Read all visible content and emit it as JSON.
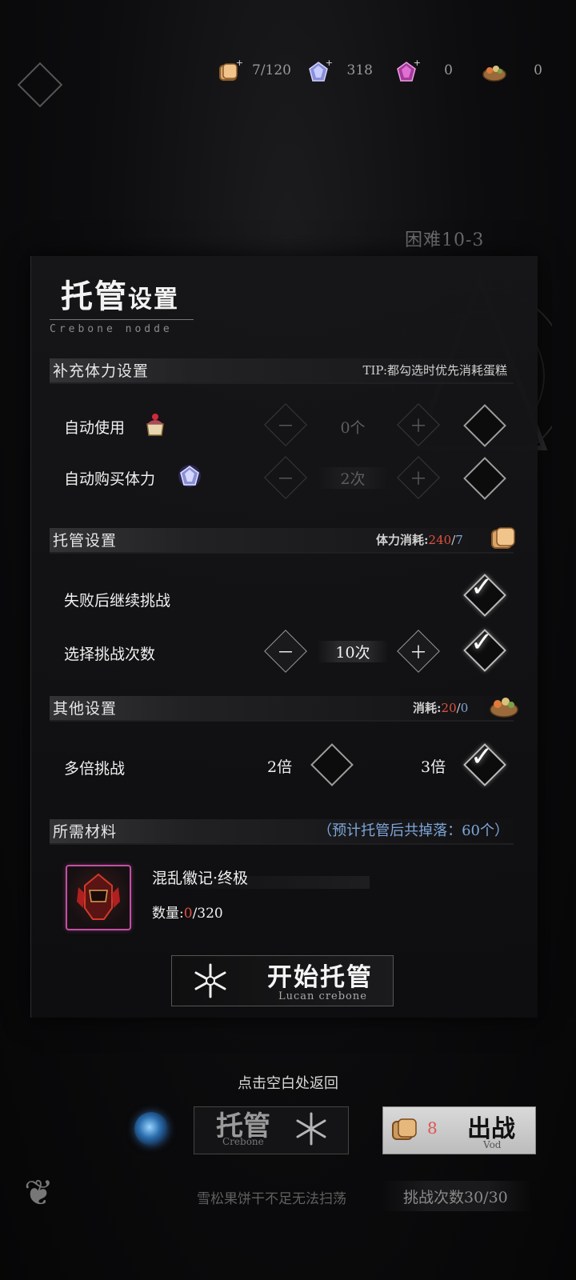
{
  "resources": [
    {
      "icon": "bread-icon",
      "value": "7/120"
    },
    {
      "icon": "blue-crystal-icon",
      "value": "318"
    },
    {
      "icon": "purple-crystal-icon",
      "value": "0"
    },
    {
      "icon": "food-basket-icon",
      "value": "0"
    }
  ],
  "background": {
    "stage": "困难10-3"
  },
  "panel": {
    "title_big": "托管",
    "title_small": "设置",
    "subtitle": "Crebone nodde",
    "stamina_section": {
      "title": "补充体力设置",
      "tip": "TIP:都勾选时优先消耗蛋糕",
      "rows": [
        {
          "label": "自动使用",
          "value": "0个",
          "icon": "cake-icon",
          "checked": false
        },
        {
          "label": "自动购买体力",
          "value": "2次",
          "icon": "crystal-icon",
          "checked": false
        }
      ]
    },
    "auto_section": {
      "title": "托管设置",
      "cost_label": "体力消耗:",
      "cost_used": "240",
      "cost_sep": "/",
      "cost_have": "7",
      "rows": [
        {
          "label": "失败后继续挑战",
          "checked": true
        },
        {
          "label": "选择挑战次数",
          "value": "10次",
          "checked": true
        }
      ]
    },
    "other_section": {
      "title": "其他设置",
      "cost_label": "消耗:",
      "cost_used": "20",
      "cost_sep": "/",
      "cost_have": "0",
      "multi": {
        "label": "多倍挑战",
        "opt2": "2倍",
        "opt3": "3倍",
        "opt2_checked": false,
        "opt3_checked": true
      }
    },
    "materials_section": {
      "title": "所需材料",
      "drop_note": "（预计托管后共掉落：60个）",
      "item": {
        "name": "混乱徽记·终极",
        "qty_label": "数量:",
        "qty_have": "0",
        "qty_sep": "/",
        "qty_need": "320"
      }
    },
    "start_button": {
      "label": "开始托管",
      "sub": "Lucan crebone"
    }
  },
  "hint": "点击空白处返回",
  "bottom": {
    "auto_label": "托管",
    "auto_sub": "Crebone",
    "battle_cost": "8",
    "battle_label": "出战",
    "battle_sub": "Vod",
    "note": "雪松果饼干不足无法扫荡",
    "challenge_count": "挑战次数30/30"
  },
  "colors": {
    "accent_red": "#e0513f",
    "accent_blue": "#7da6d9",
    "item_border": "#c44fa3"
  }
}
